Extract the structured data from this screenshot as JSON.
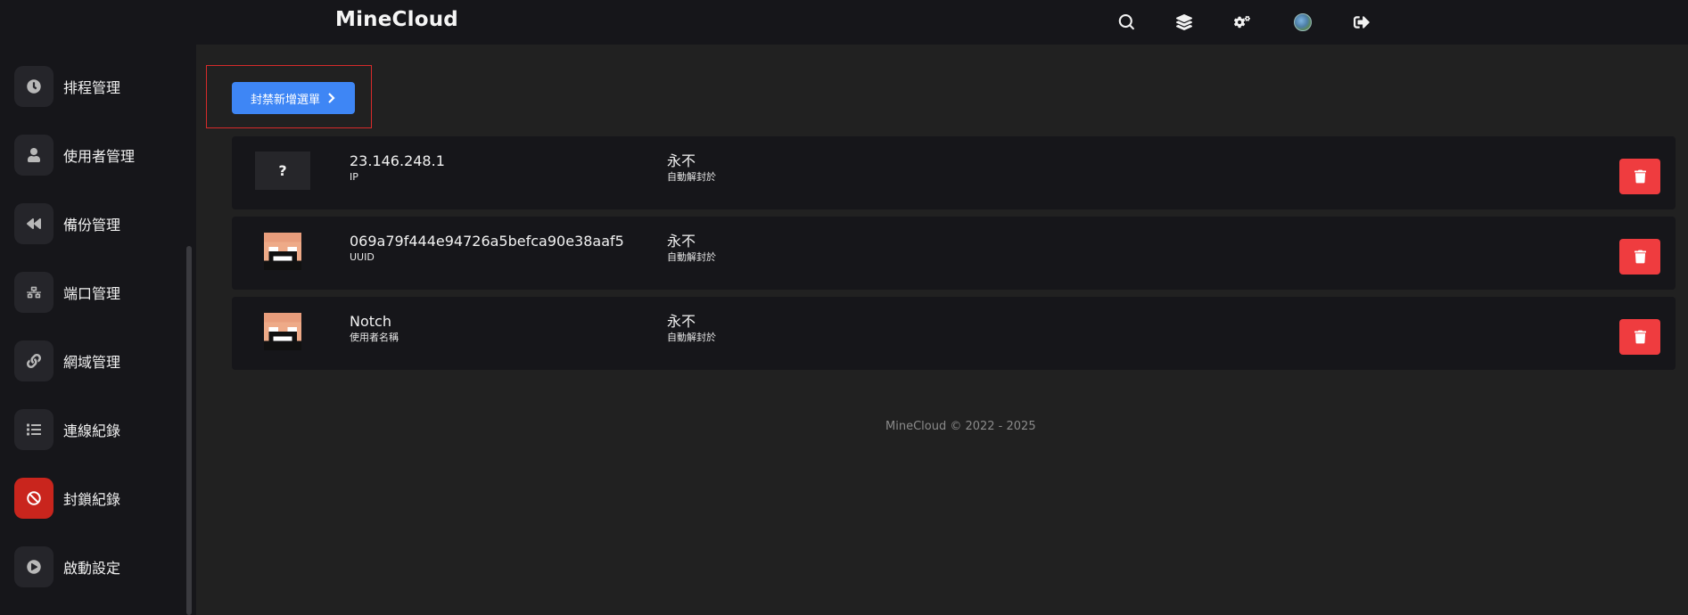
{
  "header": {
    "brand": "MineCloud",
    "icons": [
      "search-icon",
      "layers-icon",
      "cogs-icon",
      "globe-icon",
      "logout-icon"
    ]
  },
  "sidebar": {
    "items": [
      {
        "label": "排程管理",
        "icon": "clock-icon"
      },
      {
        "label": "使用者管理",
        "icon": "user-icon"
      },
      {
        "label": "備份管理",
        "icon": "backward-icon"
      },
      {
        "label": "端口管理",
        "icon": "network-icon"
      },
      {
        "label": "網域管理",
        "icon": "link-icon"
      },
      {
        "label": "連線紀錄",
        "icon": "list-icon"
      },
      {
        "label": "封鎖紀錄",
        "icon": "ban-icon",
        "active": true
      },
      {
        "label": "啟動設定",
        "icon": "play-icon"
      }
    ]
  },
  "main": {
    "add_button_label": "封禁新增選單",
    "bans": [
      {
        "avatar": "?",
        "value": "23.146.248.1",
        "type": "IP",
        "expires": "永不",
        "expires_label": "自動解封於"
      },
      {
        "avatar": "skin",
        "value": "069a79f444e94726a5befca90e38aaf5",
        "type": "UUID",
        "expires": "永不",
        "expires_label": "自動解封於"
      },
      {
        "avatar": "skin",
        "value": "Notch",
        "type": "使用者名稱",
        "expires": "永不",
        "expires_label": "自動解封於"
      }
    ]
  },
  "footer": {
    "text": "MineCloud © 2022 - 2025"
  },
  "colors": {
    "accent": "#3e86f5",
    "danger": "#ef3c3f",
    "active": "#c9251d"
  }
}
